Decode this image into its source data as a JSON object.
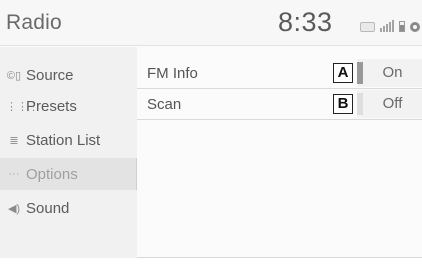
{
  "header": {
    "title": "Radio",
    "clock": "8:33",
    "status_icons": [
      "bluetooth-icon",
      "signal-icon",
      "battery-icon",
      "settings-icon"
    ]
  },
  "sidebar": {
    "items": [
      {
        "label": "Source",
        "icon": "source-icon",
        "selected": false
      },
      {
        "label": "Presets",
        "icon": "presets-icon",
        "selected": false
      },
      {
        "label": "Station List",
        "icon": "station-list-icon",
        "selected": false
      },
      {
        "label": "Options",
        "icon": "options-icon",
        "selected": true
      },
      {
        "label": "Sound",
        "icon": "sound-icon",
        "selected": false
      }
    ]
  },
  "options": {
    "rows": [
      {
        "label": "FM Info",
        "marker": "A",
        "value": "On"
      },
      {
        "label": "Scan",
        "marker": "B",
        "value": "Off"
      }
    ]
  }
}
